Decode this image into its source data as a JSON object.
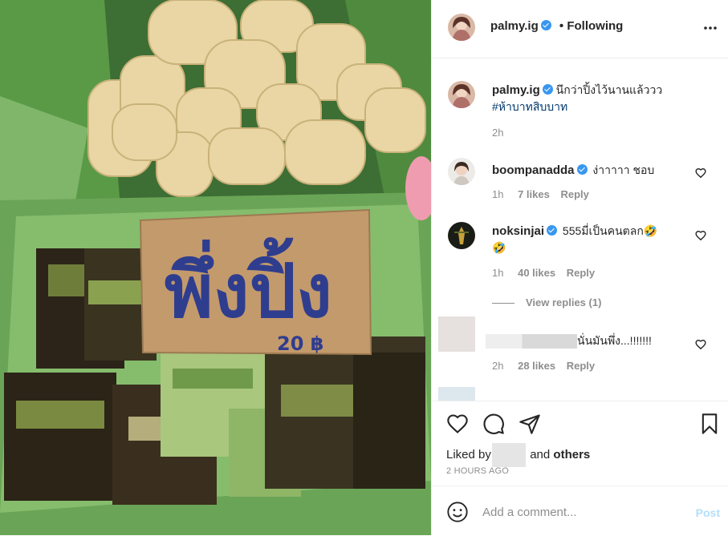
{
  "header": {
    "username": "palmy.ig",
    "following": "• Following",
    "more_icon": "more-horizontal-icon"
  },
  "caption": {
    "username": "palmy.ig",
    "text": "นึกว่าปิ้งไว้นานแล้ววว",
    "hashtag": "#ห้าบาทสิบบาท",
    "time": "2h"
  },
  "comments": [
    {
      "username": "boompanadda",
      "text": "ง่าาาาา ชอบ",
      "time": "1h",
      "likes": "7 likes",
      "reply": "Reply"
    },
    {
      "username": "noksinjai",
      "text": "555มี่เป็นคนตลก🤣",
      "text2": "🤣",
      "time": "1h",
      "likes": "40 likes",
      "reply": "Reply",
      "view_replies": "View replies (1)"
    },
    {
      "username": "",
      "text": "นั่นมันพึ่ง...!!!!!!!",
      "time": "2h",
      "likes": "28 likes",
      "reply": "Reply"
    }
  ],
  "photo": {
    "sign_text": "พึ่งปิ้ง",
    "price_text": "20 ฿"
  },
  "actions": {
    "liked_by": "Liked by",
    "and_text": "and",
    "others": "others",
    "timestamp": "2 HOURS AGO"
  },
  "add_comment": {
    "placeholder": "Add a comment...",
    "post": "Post"
  },
  "colors": {
    "link": "#00376b",
    "verified": "#3897f0",
    "muted": "#8e8e8e",
    "post_disabled": "#b2dffc"
  }
}
